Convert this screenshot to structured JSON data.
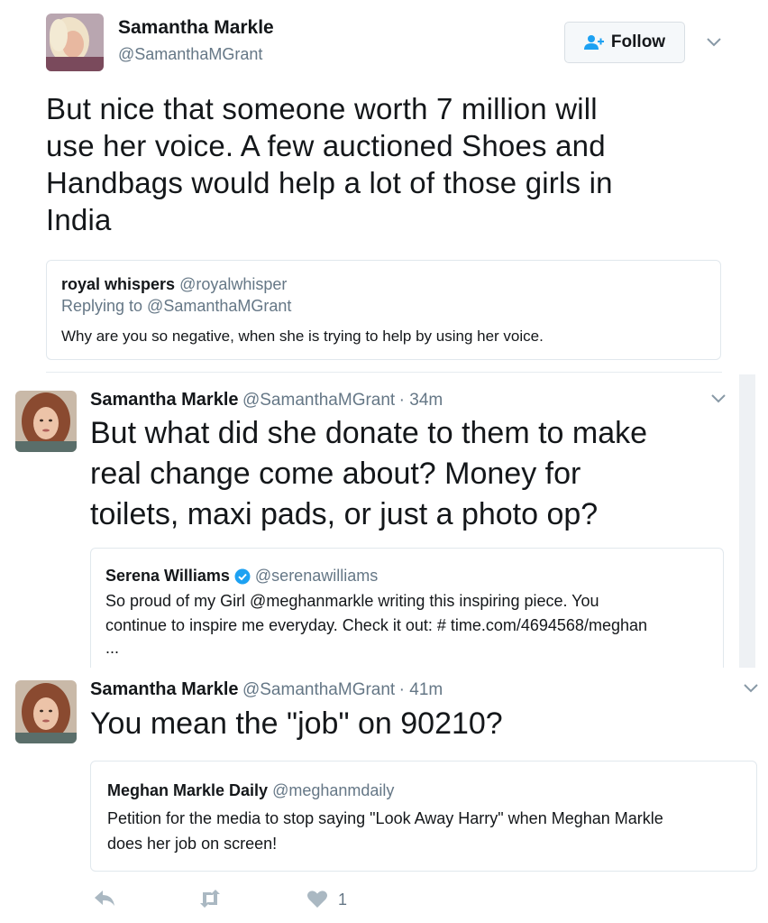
{
  "main_tweet": {
    "name": "Samantha Markle",
    "handle": "@SamanthaMGrant",
    "follow_label": "Follow",
    "text_lines": [
      "But nice that someone worth 7 million will",
      "use her voice. A few auctioned Shoes and",
      "Handbags would help a lot of those girls in",
      "India"
    ],
    "quote": {
      "name": "royal whispers",
      "handle": "@royalwhisper",
      "replying": "Replying to @SamanthaMGrant",
      "text": "Why are you so negative, when she is trying to help by using her voice."
    }
  },
  "tweet2": {
    "name": "Samantha Markle",
    "handle": "@SamanthaMGrant",
    "time": "· 34m",
    "text_lines": [
      "But what did she donate to them to make",
      "real change come about? Money for",
      "toilets, maxi pads, or just a photo op?"
    ],
    "quote": {
      "name": "Serena Williams",
      "verified_icon": "verified-badge-icon",
      "handle": "@serenawilliams",
      "line1": "So proud of my Girl @meghanmarkle writing this inspiring piece. You",
      "line2": "continue to inspire me everyday. Check it out: # time.com/4694568/meghan",
      "line3": "..."
    }
  },
  "tweet3": {
    "name": "Samantha Markle",
    "handle": "@SamanthaMGrant",
    "time": "· 41m",
    "text": "You mean the \"job\" on 90210?",
    "quote": {
      "name": "Meghan Markle Daily",
      "handle": "@meghanmdaily",
      "line1": "Petition for the media to stop saying \"Look Away Harry\" when Meghan Markle",
      "line2": "does her job on screen!"
    },
    "like_count": "1"
  },
  "colors": {
    "text": "#14171a",
    "muted": "#657786",
    "border": "#e1e8ed",
    "accent": "#1da1f2",
    "icon_gray": "#aab8c2"
  }
}
